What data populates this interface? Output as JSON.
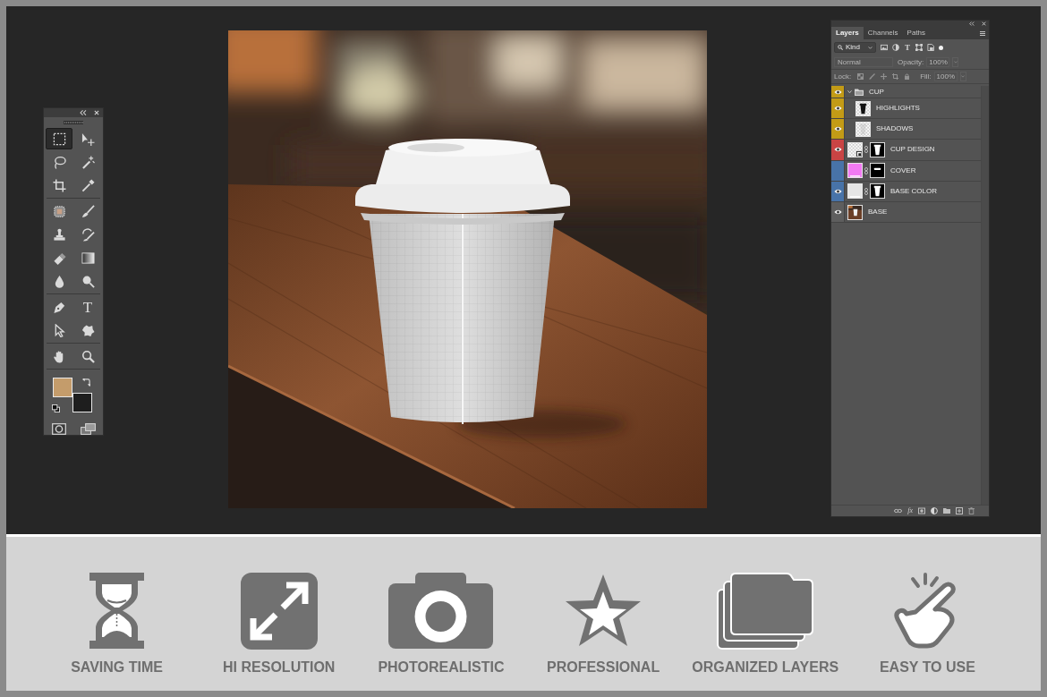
{
  "tools_panel": {
    "tool_groups": [
      {
        "tools": [
          {
            "kind": "marquee",
            "selected": true
          },
          {
            "kind": "move",
            "selected": false
          },
          {
            "kind": "lasso",
            "selected": false
          },
          {
            "kind": "wand",
            "selected": false
          },
          {
            "kind": "crop",
            "selected": false
          },
          {
            "kind": "eyedropper",
            "selected": false
          }
        ]
      },
      {
        "tools": [
          {
            "kind": "healing",
            "selected": false
          },
          {
            "kind": "brush",
            "selected": false
          },
          {
            "kind": "stamp",
            "selected": false
          },
          {
            "kind": "history",
            "selected": false
          },
          {
            "kind": "eraser",
            "selected": false
          },
          {
            "kind": "gradient",
            "selected": false
          },
          {
            "kind": "blur",
            "selected": false
          },
          {
            "kind": "dodge",
            "selected": false
          }
        ]
      },
      {
        "tools": [
          {
            "kind": "pen",
            "selected": false
          },
          {
            "kind": "type",
            "glyph": "T",
            "selected": false
          },
          {
            "kind": "path",
            "selected": false
          },
          {
            "kind": "shape",
            "selected": false
          }
        ]
      },
      {
        "tools": [
          {
            "kind": "hand",
            "selected": false
          },
          {
            "kind": "zoom",
            "selected": false
          }
        ]
      }
    ],
    "swatches": [
      {
        "kind": "foreground",
        "color": "#c49c6b"
      },
      {
        "kind": "background",
        "color": "#1e1e1e"
      }
    ]
  },
  "layers_panel": {
    "tabs": [
      {
        "label": "Layers",
        "selected": true
      },
      {
        "label": "Channels",
        "selected": false
      },
      {
        "label": "Paths",
        "selected": false
      }
    ],
    "filter": {
      "value": "Kind"
    },
    "filters": [
      {
        "kind": "pixel"
      },
      {
        "kind": "adjustment"
      },
      {
        "kind": "type",
        "glyph": "T"
      },
      {
        "kind": "shape"
      },
      {
        "kind": "smart"
      }
    ],
    "blend_mode": {
      "value": "Normal",
      "disabled": true
    },
    "opacity": {
      "label": "Opacity:",
      "value": "100%",
      "disabled": true
    },
    "lock": {
      "label": "Lock:",
      "disabled": true
    },
    "fill": {
      "label": "Fill:",
      "value": "100%",
      "disabled": true
    },
    "layers": [
      {
        "name": "CUP",
        "kind": "group",
        "visible": true,
        "color": "#c39b16",
        "expanded": true,
        "children": [
          {
            "name": "HIGHLIGHTS",
            "kind": "layer",
            "thumbnail": {
              "kind": "pixel"
            },
            "visible": true,
            "color": "#c39b16"
          },
          {
            "name": "SHADOWS",
            "kind": "layer",
            "thumbnail": {
              "kind": "transparent"
            },
            "visible": true,
            "color": "#c39b16"
          }
        ]
      },
      {
        "name": "CUP DESIGN",
        "kind": "layer",
        "thumbnail": {
          "kind": "smart"
        },
        "mask": {
          "kind": "cup"
        },
        "visible": true,
        "color": "#c94444"
      },
      {
        "name": "COVER",
        "kind": "layer",
        "thumbnail": {
          "kind": "fill",
          "color": "#f27af3"
        },
        "mask": {
          "kind": "lid"
        },
        "visible": false,
        "color": "#4873a8"
      },
      {
        "name": "BASE COLOR",
        "kind": "layer",
        "thumbnail": {
          "kind": "fill",
          "color": "#e6e6e6"
        },
        "mask": {
          "kind": "cup"
        },
        "visible": true,
        "color": "#4873a8"
      },
      {
        "name": "BASE",
        "kind": "layer",
        "thumbnail": {
          "kind": "photo"
        },
        "visible": true
      }
    ],
    "footer_buttons": [
      {
        "kind": "link"
      },
      {
        "kind": "style",
        "text": "fx"
      },
      {
        "kind": "mask"
      },
      {
        "kind": "adjustment"
      },
      {
        "kind": "group"
      },
      {
        "kind": "new"
      },
      {
        "kind": "delete"
      }
    ]
  },
  "features": [
    {
      "kind": "hourglass",
      "label": "SAVING TIME"
    },
    {
      "kind": "resize",
      "label": "HI RESOLUTION"
    },
    {
      "kind": "camera",
      "label": "PHOTOREALISTIC"
    },
    {
      "kind": "star",
      "label": "PROFESSIONAL"
    },
    {
      "kind": "folders",
      "label": "ORGANIZED LAYERS"
    },
    {
      "kind": "tap",
      "label": "EASY TO USE"
    }
  ]
}
